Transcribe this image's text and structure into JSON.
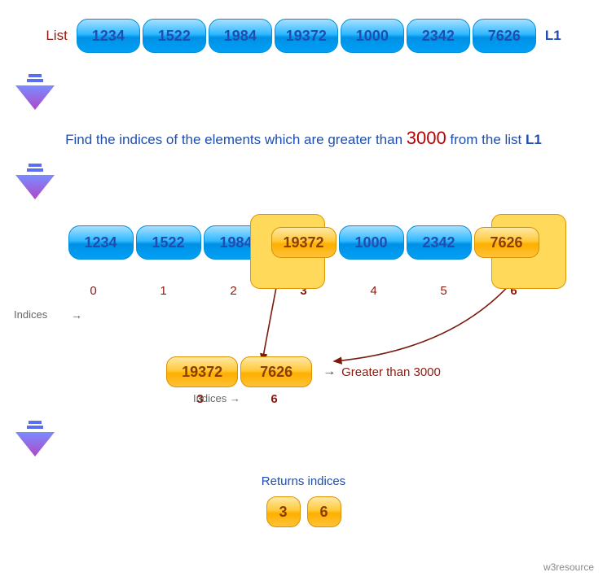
{
  "labels": {
    "list": "List",
    "l1": "L1",
    "caption_pre": "Find the indices of the elements which are greater than ",
    "threshold": "3000",
    "caption_mid": " from the list ",
    "caption_list": "L1",
    "indices": "Indices",
    "arrow_char": "→",
    "greater": "Greater than 3000",
    "returns": "Returns indices",
    "credit": "w3resource"
  },
  "list_values": [
    "1234",
    "1522",
    "1984",
    "19372",
    "1000",
    "2342",
    "7626"
  ],
  "indices_row": [
    "0",
    "1",
    "2",
    "3",
    "4",
    "5",
    "6"
  ],
  "highlighted_idx": [
    "3",
    "6"
  ],
  "filtered_values": [
    "19372",
    "7626"
  ],
  "filtered_indices": [
    "3",
    "6"
  ],
  "result": [
    "3",
    "6"
  ],
  "chart_data": {
    "type": "table",
    "title": "Find indices of list elements greater than 3000",
    "list_name": "L1",
    "threshold": 3000,
    "elements": [
      {
        "index": 0,
        "value": 1234,
        "gt_threshold": false
      },
      {
        "index": 1,
        "value": 1522,
        "gt_threshold": false
      },
      {
        "index": 2,
        "value": 1984,
        "gt_threshold": false
      },
      {
        "index": 3,
        "value": 19372,
        "gt_threshold": true
      },
      {
        "index": 4,
        "value": 1000,
        "gt_threshold": false
      },
      {
        "index": 5,
        "value": 2342,
        "gt_threshold": false
      },
      {
        "index": 6,
        "value": 7626,
        "gt_threshold": true
      }
    ],
    "result_indices": [
      3,
      6
    ]
  }
}
